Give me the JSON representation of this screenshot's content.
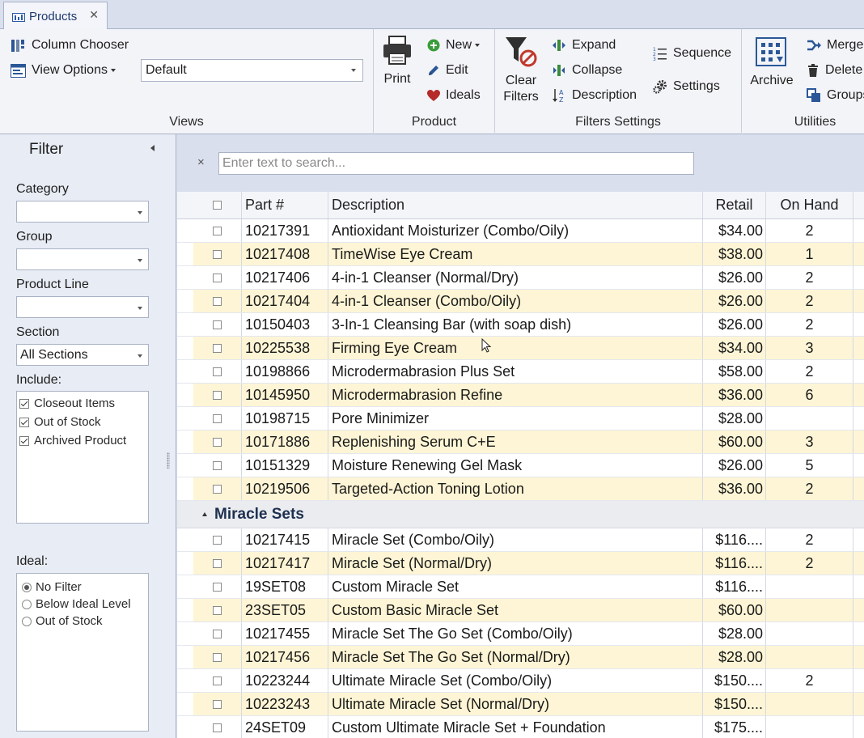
{
  "tab": {
    "title": "Products",
    "close": "✕"
  },
  "ribbon": {
    "views": {
      "column_chooser": "Column Chooser",
      "view_options": "View Options",
      "view_select": "Default",
      "label": "Views"
    },
    "product": {
      "print": "Print",
      "new": "New",
      "edit": "Edit",
      "ideals": "Ideals",
      "label": "Product"
    },
    "filters": {
      "clear_line1": "Clear",
      "clear_line2": "Filters",
      "expand": "Expand",
      "collapse": "Collapse",
      "description": "Description",
      "sequence": "Sequence",
      "settings": "Settings",
      "label": "Filters  Settings"
    },
    "utilities": {
      "archive": "Archive",
      "merge": "Merge",
      "delete": "Delete",
      "groups": "Groups",
      "label": "Utilities"
    }
  },
  "filter": {
    "title": "Filter",
    "category_label": "Category",
    "category_value": "",
    "group_label": "Group",
    "group_value": "",
    "product_line_label": "Product Line",
    "product_line_value": "",
    "section_label": "Section",
    "section_value": "All Sections",
    "include_label": "Include:",
    "include_items": [
      {
        "label": "Closeout Items",
        "checked": true
      },
      {
        "label": "Out of Stock",
        "checked": true
      },
      {
        "label": "Archived Product",
        "checked": true
      }
    ],
    "ideal_label": "Ideal:",
    "ideal_options": [
      {
        "label": "No Filter",
        "selected": true
      },
      {
        "label": "Below Ideal Level",
        "selected": false
      },
      {
        "label": "Out of Stock",
        "selected": false
      }
    ]
  },
  "search": {
    "clear": "×",
    "placeholder": "Enter text to search..."
  },
  "grid": {
    "columns": {
      "part": "Part #",
      "description": "Description",
      "retail": "Retail",
      "on_hand": "On Hand"
    },
    "rows": [
      {
        "part": "10217391",
        "description": "Antioxidant Moisturizer (Combo/Oily)",
        "retail": "$34.00",
        "on_hand": "2"
      },
      {
        "part": "10217408",
        "description": "TimeWise Eye Cream",
        "retail": "$38.00",
        "on_hand": "1"
      },
      {
        "part": "10217406",
        "description": "4-in-1 Cleanser (Normal/Dry)",
        "retail": "$26.00",
        "on_hand": "2"
      },
      {
        "part": "10217404",
        "description": "4-in-1 Cleanser (Combo/Oily)",
        "retail": "$26.00",
        "on_hand": "2"
      },
      {
        "part": "10150403",
        "description": "3-In-1 Cleansing Bar (with soap dish)",
        "retail": "$26.00",
        "on_hand": "2"
      },
      {
        "part": "10225538",
        "description": "Firming Eye Cream",
        "retail": "$34.00",
        "on_hand": "3"
      },
      {
        "part": "10198866",
        "description": "Microdermabrasion Plus Set",
        "retail": "$58.00",
        "on_hand": "2"
      },
      {
        "part": "10145950",
        "description": "Microdermabrasion Refine",
        "retail": "$36.00",
        "on_hand": "6"
      },
      {
        "part": "10198715",
        "description": "Pore Minimizer",
        "retail": "$28.00",
        "on_hand": ""
      },
      {
        "part": "10171886",
        "description": "Replenishing Serum C+E",
        "retail": "$60.00",
        "on_hand": "3"
      },
      {
        "part": "10151329",
        "description": "Moisture Renewing Gel Mask",
        "retail": "$26.00",
        "on_hand": "5"
      },
      {
        "part": "10219506",
        "description": "Targeted-Action Toning Lotion",
        "retail": "$36.00",
        "on_hand": "2"
      }
    ],
    "group": {
      "label": "Miracle Sets"
    },
    "group_rows": [
      {
        "part": "10217415",
        "description": "Miracle Set (Combo/Oily)",
        "retail": "$116....",
        "on_hand": "2"
      },
      {
        "part": "10217417",
        "description": "Miracle Set (Normal/Dry)",
        "retail": "$116....",
        "on_hand": "2"
      },
      {
        "part": "19SET08",
        "description": "Custom Miracle Set",
        "retail": "$116....",
        "on_hand": ""
      },
      {
        "part": "23SET05",
        "description": "Custom Basic Miracle Set",
        "retail": "$60.00",
        "on_hand": ""
      },
      {
        "part": "10217455",
        "description": "Miracle Set The Go Set (Combo/Oily)",
        "retail": "$28.00",
        "on_hand": ""
      },
      {
        "part": "10217456",
        "description": "Miracle Set The Go Set (Normal/Dry)",
        "retail": "$28.00",
        "on_hand": ""
      },
      {
        "part": "10223244",
        "description": "Ultimate Miracle Set (Combo/Oily)",
        "retail": "$150....",
        "on_hand": "2"
      },
      {
        "part": "10223243",
        "description": "Ultimate Miracle Set (Normal/Dry)",
        "retail": "$150....",
        "on_hand": ""
      },
      {
        "part": "24SET09",
        "description": "Custom Ultimate Miracle Set + Foundation",
        "retail": "$175....",
        "on_hand": ""
      }
    ]
  }
}
